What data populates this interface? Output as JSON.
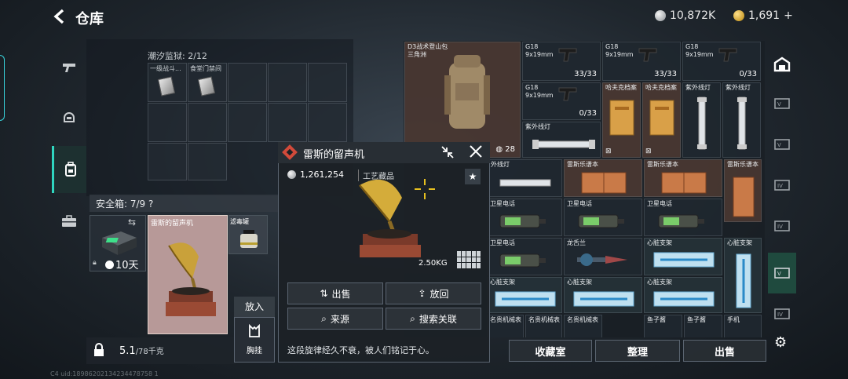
{
  "header": {
    "title": "仓库",
    "currency_silver": "10,872K",
    "currency_gold": "1,691",
    "currency_gold_suffix": "+"
  },
  "container": {
    "label": "潮汐监狱: 2/12",
    "items": [
      "一级战斗...",
      "食堂门禁间"
    ]
  },
  "safebox": {
    "label": "安全箱: 7/9 ?",
    "time": "10天",
    "highlight_item_label": "雷斯的留声机",
    "filter_item_label": "滤毒罐"
  },
  "status": {
    "weight_current": "5.1",
    "weight_max": "/78千克",
    "put_label": "放入",
    "chest_label": "胸挂",
    "player_id": "C4 uid:18986202134234478758 1"
  },
  "popup": {
    "title": "雷斯的留声机",
    "price": "1,261,254",
    "category": "工艺藏品",
    "weight": "2.50KG",
    "description": "这段旋律经久不衰，被人们铭记于心。",
    "buttons": {
      "sell": "出售",
      "return": "放回",
      "source": "来源",
      "search_related": "搜索关联"
    }
  },
  "inventory": {
    "backpack_label": "D3战术登山包\n三角洲",
    "backpack_count": "28",
    "cells": [
      {
        "label": "G18\n9x19mm",
        "count": "33/33"
      },
      {
        "label": "G18\n9x19mm",
        "count": "33/33"
      },
      {
        "label": "G18\n9x19mm",
        "count": "0/33"
      },
      {
        "label": "G18\n9x19mm",
        "count": "0/33"
      },
      {
        "label": "哈夫克档案",
        "count": ""
      },
      {
        "label": "哈夫克档案",
        "count": ""
      },
      {
        "label": "紫外线灯",
        "count": ""
      },
      {
        "label": "紫外线灯",
        "count": ""
      },
      {
        "label": "紫外线灯",
        "count": ""
      },
      {
        "label": "外线灯",
        "count": ""
      },
      {
        "label": "雷斯乐谱本",
        "count": ""
      },
      {
        "label": "雷斯乐谱本",
        "count": ""
      },
      {
        "label": "雷斯乐谱本",
        "count": ""
      },
      {
        "label": "卫星电话",
        "count": ""
      },
      {
        "label": "卫星电话",
        "count": ""
      },
      {
        "label": "卫星电话",
        "count": ""
      },
      {
        "label": "卫星电话",
        "count": ""
      },
      {
        "label": "龙舌兰",
        "count": ""
      },
      {
        "label": "心脏支架",
        "count": ""
      },
      {
        "label": "心脏支架",
        "count": ""
      },
      {
        "label": "心脏支架",
        "count": ""
      },
      {
        "label": "心脏支架",
        "count": ""
      },
      {
        "label": "心脏支架",
        "count": ""
      },
      {
        "label": "名贵机械表",
        "count": ""
      },
      {
        "label": "名贵机械表",
        "count": ""
      },
      {
        "label": "名贵机械表",
        "count": ""
      },
      {
        "label": "鱼子酱",
        "count": ""
      },
      {
        "label": "鱼子酱",
        "count": ""
      },
      {
        "label": "手机",
        "count": ""
      }
    ]
  },
  "bottom_buttons": {
    "collection": "收藏室",
    "organize": "整理",
    "sell": "出售"
  },
  "colors": {
    "accent_teal": "#2fd6c0",
    "rarity_red": "#d24a3a",
    "highlight_item_bg": "#b79998"
  }
}
